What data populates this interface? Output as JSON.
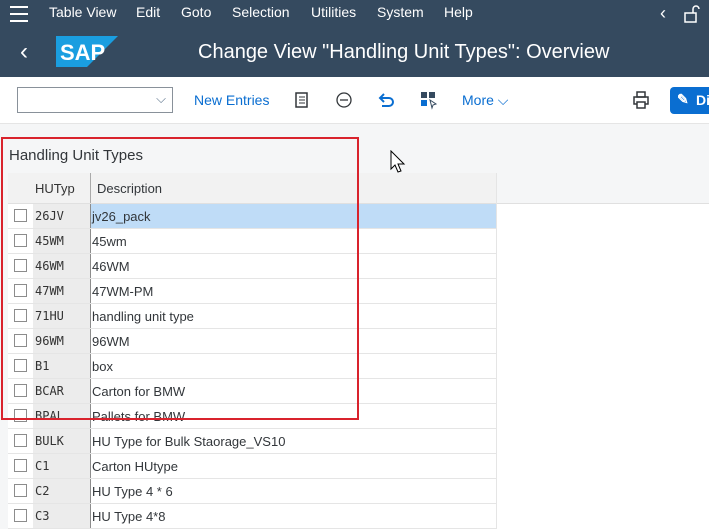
{
  "menubar": {
    "items": [
      "Table View",
      "Edit",
      "Goto",
      "Selection",
      "Utilities",
      "System",
      "Help"
    ]
  },
  "header": {
    "back": "‹",
    "logo_text": "SAP",
    "title": "Change View \"Handling Unit Types\": Overview"
  },
  "toolbar": {
    "select_value": "",
    "new_entries": "New Entries",
    "more": "More",
    "display_button": "Di"
  },
  "table": {
    "title": "Handling Unit Types",
    "columns": [
      "HUTyp",
      "Description"
    ],
    "rows": [
      {
        "key": "26JV",
        "desc": "jv26_pack",
        "selected": true
      },
      {
        "key": "45WM",
        "desc": "45wm"
      },
      {
        "key": "46WM",
        "desc": "46WM"
      },
      {
        "key": "47WM",
        "desc": "47WM-PM"
      },
      {
        "key": "71HU",
        "desc": "handling unit type"
      },
      {
        "key": "96WM",
        "desc": "96WM"
      },
      {
        "key": "B1",
        "desc": "box"
      },
      {
        "key": "BCAR",
        "desc": "Carton for BMW"
      },
      {
        "key": "BPAL",
        "desc": "Pallets for BMW"
      },
      {
        "key": "BULK",
        "desc": " HU Type for Bulk Staorage_VS10"
      },
      {
        "key": "C1",
        "desc": "Carton HUtype"
      },
      {
        "key": "C2",
        "desc": "HU Type 4 * 6"
      },
      {
        "key": "C3",
        "desc": "HU Type 4*8"
      }
    ]
  },
  "colors": {
    "shell": "#354a5f",
    "accent": "#0a6ed1",
    "selection": "#bfdcf7",
    "highlight_box": "#d9232d"
  }
}
